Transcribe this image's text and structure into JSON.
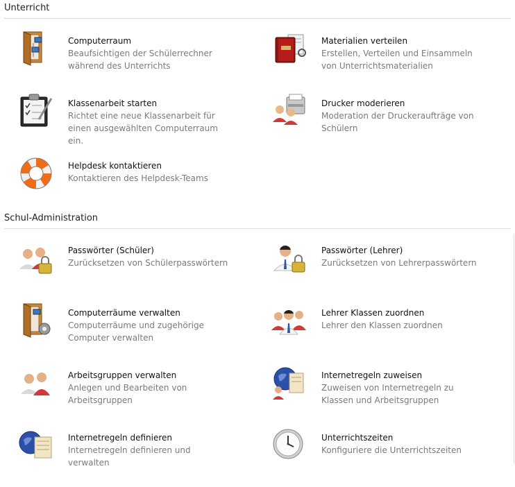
{
  "unterricht": {
    "title": "Unterricht",
    "items": [
      {
        "title": "Computerraum",
        "desc": "Beaufsichtigen der Schülerrechner während des Unterrichts",
        "icon": "door-computer-icon"
      },
      {
        "title": "Materialien verteilen",
        "desc": "Erstellen, Verteilen und Einsammeln von Unterrichtsmaterialien",
        "icon": "book-icon"
      },
      {
        "title": "Klassenarbeit starten",
        "desc": "Richtet eine neue Klassenarbeit für einen ausgewählten Computerraum ein.",
        "icon": "clipboard-icon"
      },
      {
        "title": "Drucker moderieren",
        "desc": "Moderation der Druckeraufträge von Schülern",
        "icon": "printer-users-icon"
      },
      {
        "title": "Helpdesk kontaktieren",
        "desc": "Kontaktieren des Helpdesk-Teams",
        "icon": "lifebuoy-icon"
      }
    ]
  },
  "schuladmin": {
    "title": "Schul-Administration",
    "items": [
      {
        "title": "Passwörter (Schüler)",
        "desc": "Zurücksetzen von Schülerpasswörtern",
        "icon": "students-lock-icon"
      },
      {
        "title": "Passwörter (Lehrer)",
        "desc": "Zurücksetzen von Lehrerpasswörtern",
        "icon": "teacher-lock-icon"
      },
      {
        "title": "Computerräume verwalten",
        "desc": "Computerräume und zugehörige Computer verwalten",
        "icon": "door-gear-icon"
      },
      {
        "title": "Lehrer Klassen zuordnen",
        "desc": "Lehrer den Klassen zuordnen",
        "icon": "teacher-group-icon"
      },
      {
        "title": "Arbeitsgruppen verwalten",
        "desc": "Anlegen und Bearbeiten von Arbeitsgruppen",
        "icon": "workgroup-icon"
      },
      {
        "title": "Internetregeln zuweisen",
        "desc": "Zuweisen von Internetregeln zu Klassen und Arbeitsgruppen",
        "icon": "globe-scroll-users-icon"
      },
      {
        "title": "Internetregeln definieren",
        "desc": "Internetregeln definieren und verwalten",
        "icon": "globe-scroll-icon"
      },
      {
        "title": "Unterrichtszeiten",
        "desc": "Konfiguriere die Unterrichtszeiten",
        "icon": "clock-icon"
      }
    ]
  }
}
